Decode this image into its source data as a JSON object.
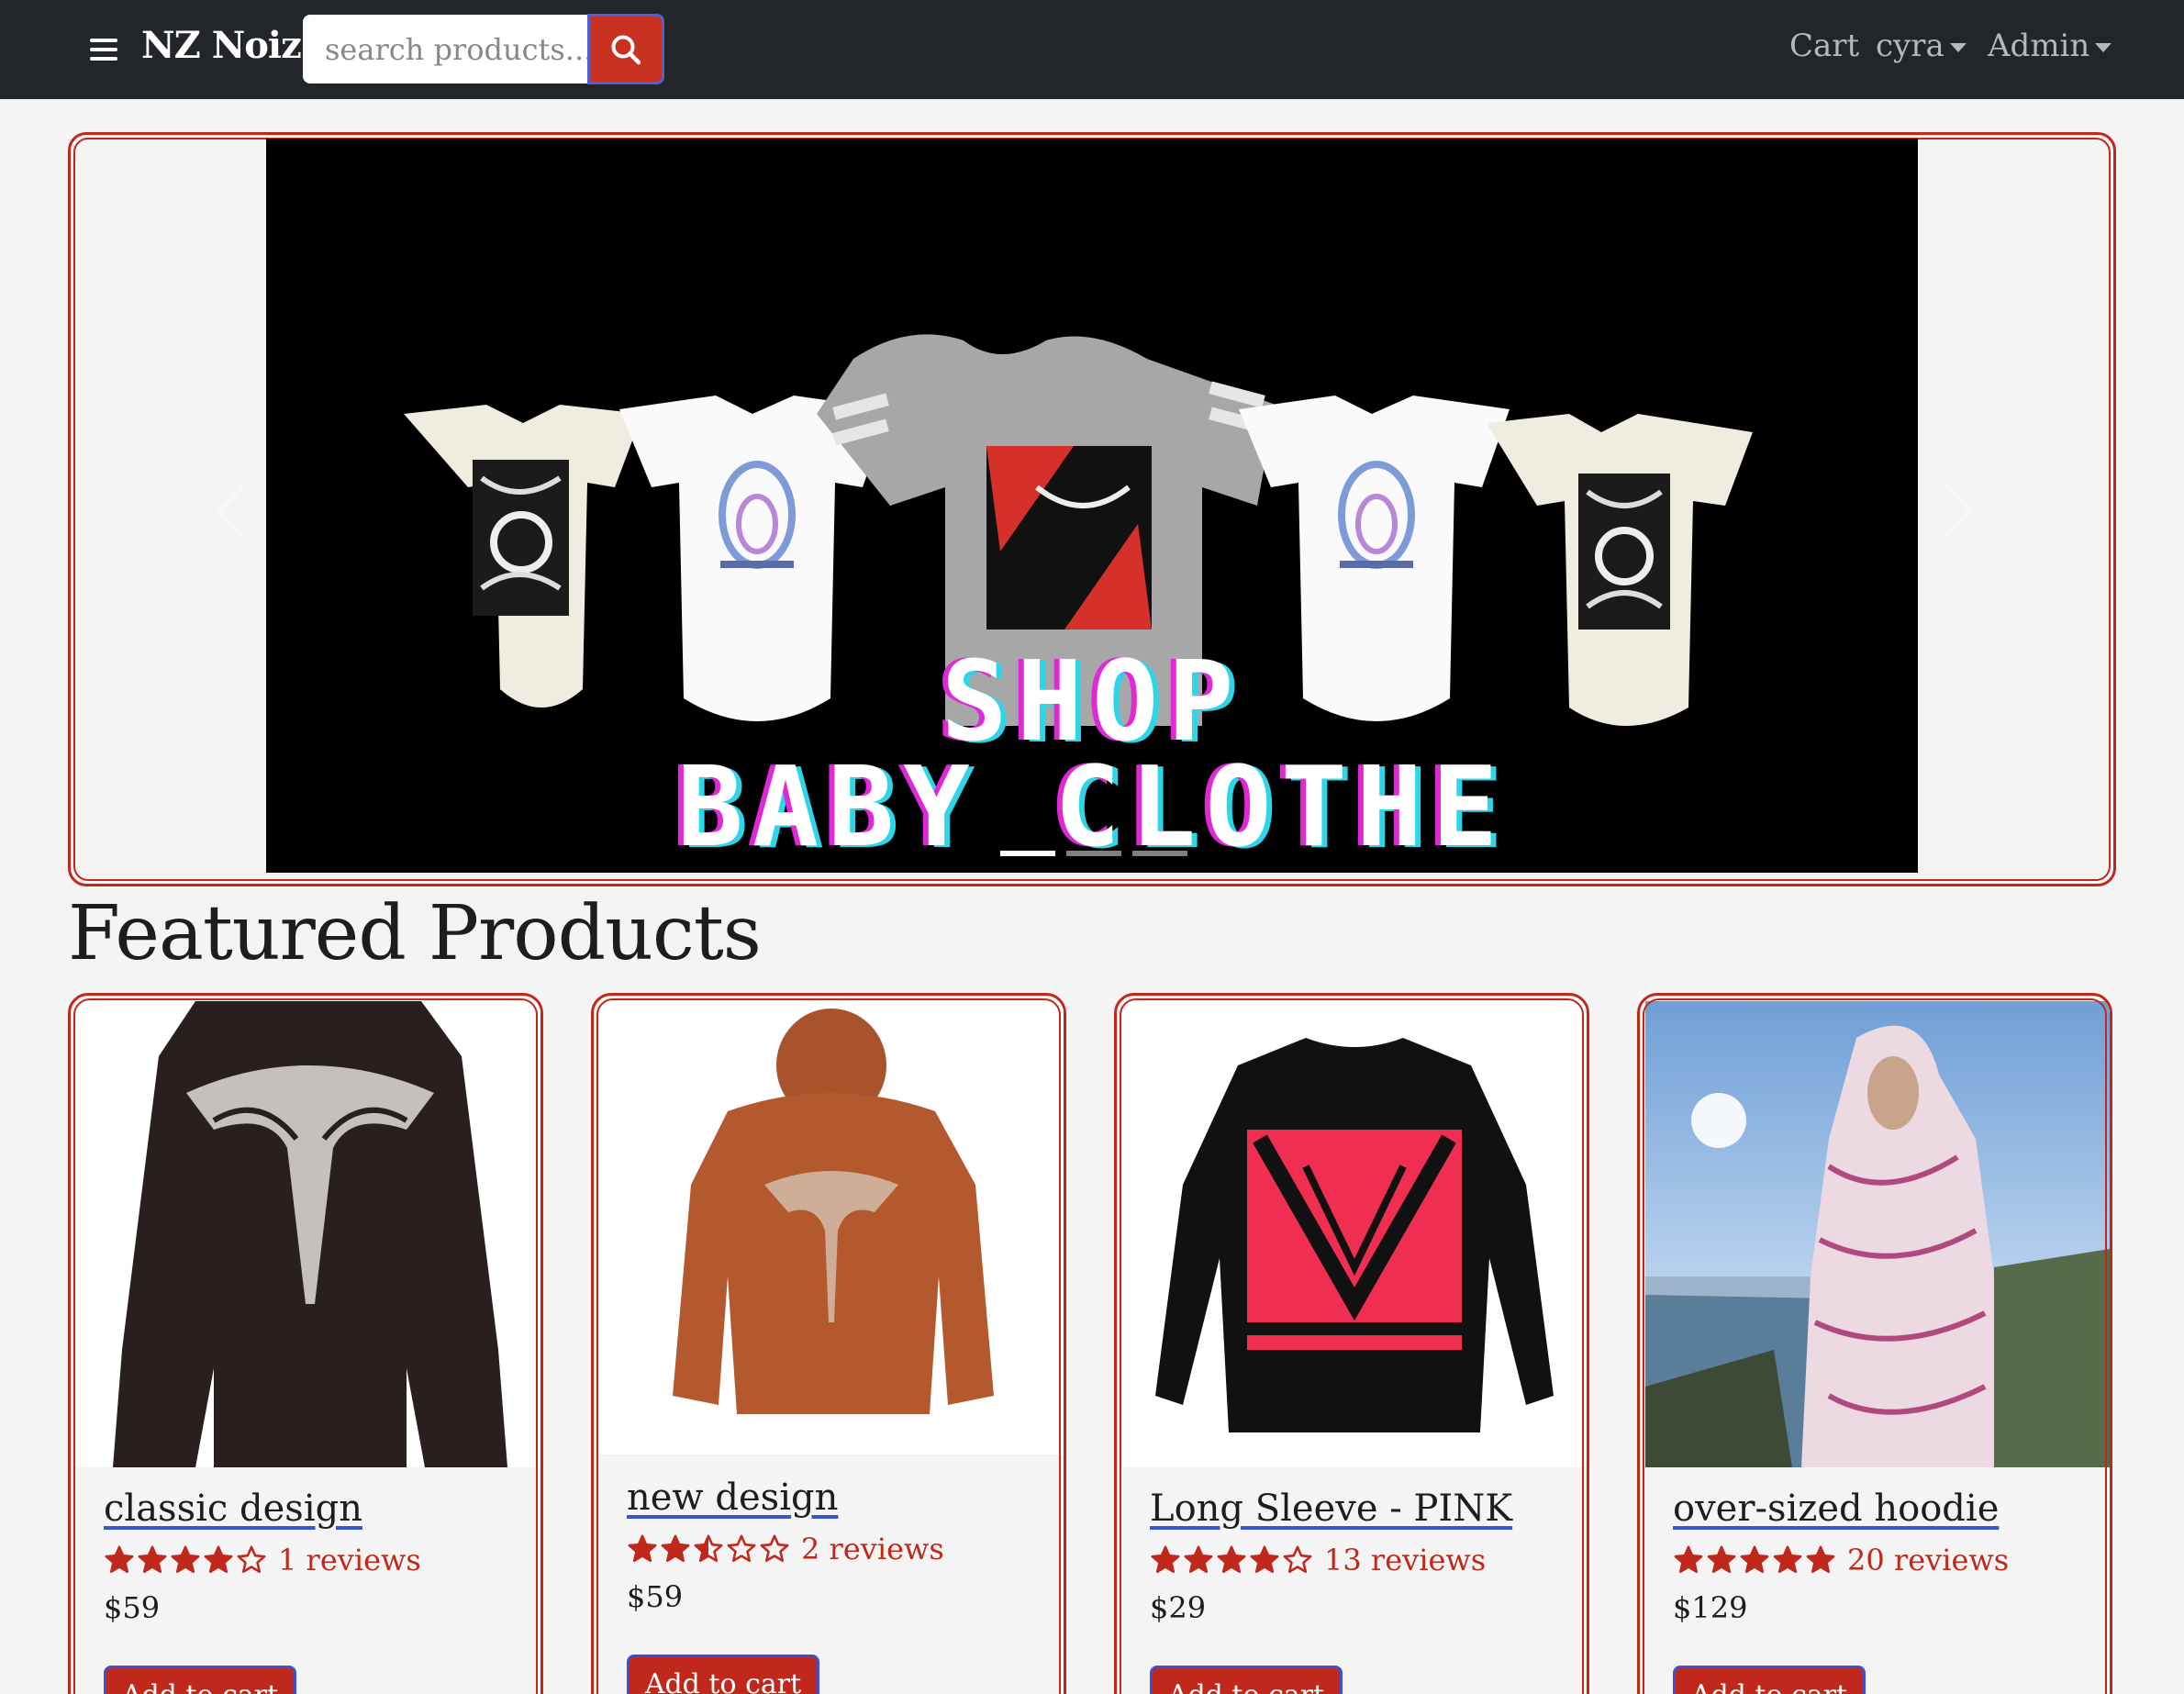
{
  "navbar": {
    "brand": "NZ Noiz",
    "search_placeholder": "search products...",
    "links": {
      "cart": "Cart",
      "user": "cyra",
      "admin": "Admin"
    }
  },
  "carousel": {
    "line1": "SHOP",
    "line2": "BABY CLOTHE",
    "slide_count": 3,
    "active_index": 0
  },
  "featured": {
    "title": "Featured Products",
    "products": [
      {
        "name": "classic design",
        "rating": 4,
        "reviews": "1 reviews",
        "price": "$59",
        "button": "Add to cart"
      },
      {
        "name": "new design",
        "rating": 2.5,
        "reviews": "2 reviews",
        "price": "$59",
        "button": "Add to cart"
      },
      {
        "name": "Long Sleeve - PINK",
        "rating": 4,
        "reviews": "13 reviews",
        "price": "$29",
        "button": "Add to cart"
      },
      {
        "name": "over-sized hoodie",
        "rating": 5,
        "reviews": "20 reviews",
        "price": "$129",
        "button": "Add to cart"
      }
    ]
  },
  "colors": {
    "navbar_bg": "#22252a",
    "accent_red": "#c0281b",
    "button_border": "#3d4fd0",
    "page_bg": "#f4f4f4"
  }
}
